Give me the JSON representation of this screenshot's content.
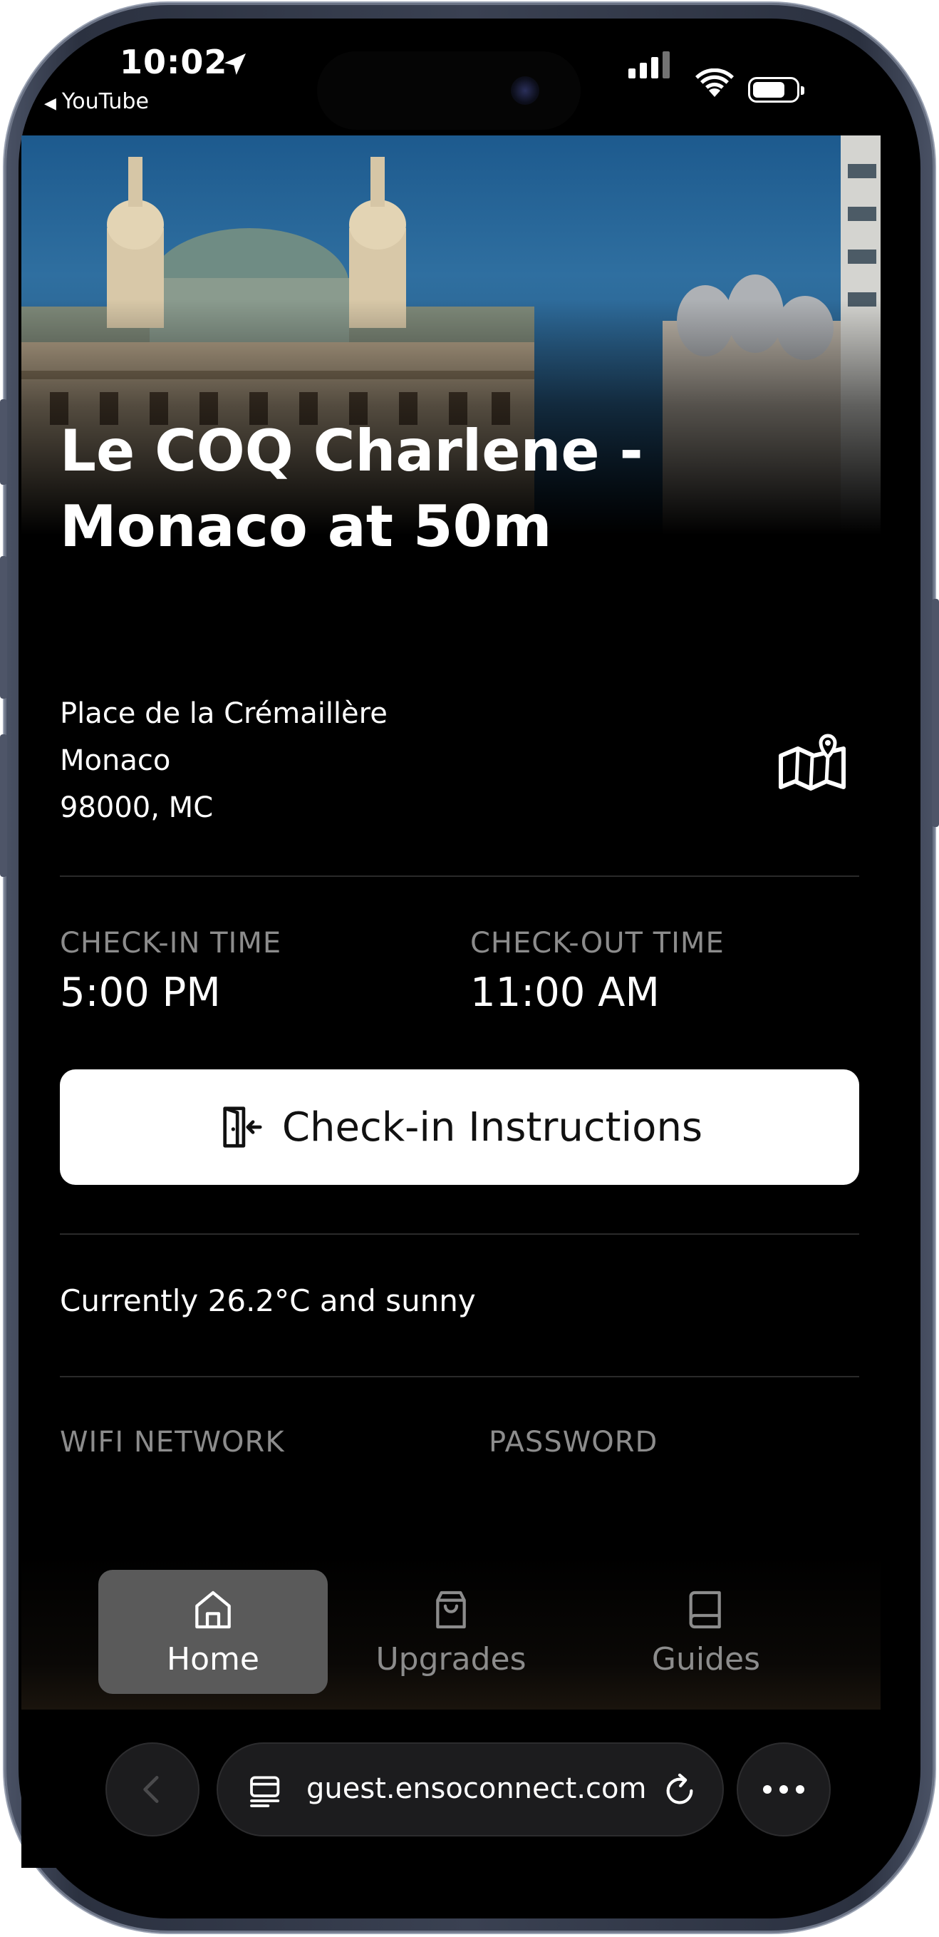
{
  "status_bar": {
    "time": "10:02",
    "back_app": "YouTube"
  },
  "hero": {
    "title_line1": "Le COQ Charlene -",
    "title_line2": "Monaco at 50m"
  },
  "address": {
    "line1": "Place de la Crémaillère",
    "line2": "Monaco",
    "line3": "98000, MC",
    "map_icon": "map-pin-icon"
  },
  "times": {
    "checkin_label": "CHECK-IN TIME",
    "checkin_value": "5:00 PM",
    "checkout_label": "CHECK-OUT TIME",
    "checkout_value": "11:00 AM"
  },
  "checkin_button": {
    "label": "Check-in Instructions",
    "icon": "door-enter-icon"
  },
  "weather": {
    "text": "Currently 26.2°C and sunny"
  },
  "wifi": {
    "network_label": "WIFI NETWORK",
    "password_label": "PASSWORD"
  },
  "bottom_nav": {
    "items": [
      {
        "label": "Home",
        "icon": "home-icon",
        "active": true
      },
      {
        "label": "Upgrades",
        "icon": "shopping-bag-icon",
        "active": false
      },
      {
        "label": "Guides",
        "icon": "book-icon",
        "active": false
      }
    ]
  },
  "browser": {
    "url": "guest.ensoconnect.com",
    "back_icon": "chevron-left-icon",
    "reader_icon": "reader-icon",
    "reload_icon": "reload-icon",
    "more_icon": "more-icon"
  },
  "colors": {
    "background": "#000000",
    "muted_label": "#8c8c8c",
    "active_nav": "#5a5a5a",
    "button_bg": "#ffffff"
  }
}
